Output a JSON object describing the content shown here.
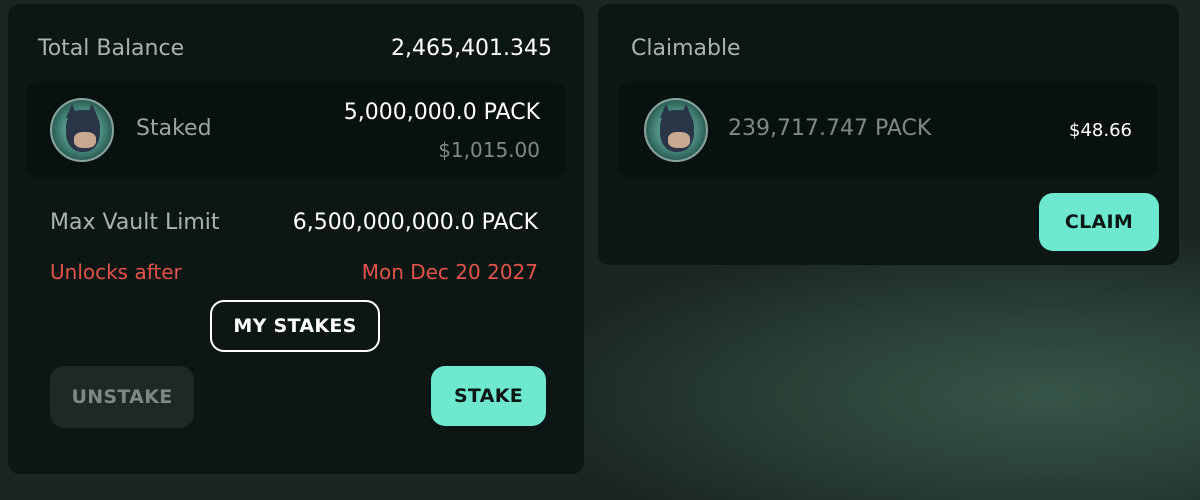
{
  "balance": {
    "total_label": "Total Balance",
    "total_value": "2,465,401.345"
  },
  "staked": {
    "label": "Staked",
    "amount": "5,000,000.0 PACK",
    "usd": "$1,015.00",
    "icon": "wolf-token-icon"
  },
  "vault": {
    "max_label": "Max Vault Limit",
    "max_value": "6,500,000,000.0 PACK",
    "unlock_label": "Unlocks after",
    "unlock_date": "Mon Dec 20 2027"
  },
  "buttons": {
    "my_stakes": "MY STAKES",
    "unstake": "UNSTAKE",
    "stake": "STAKE",
    "claim": "CLAIM"
  },
  "claimable": {
    "title": "Claimable",
    "amount": "239,717.747 PACK",
    "usd": "$48.66",
    "icon": "wolf-token-icon"
  },
  "colors": {
    "accent": "#6ee8cf",
    "warning": "#e0544a",
    "panel": "#0c1715",
    "background": "#1b2622"
  }
}
